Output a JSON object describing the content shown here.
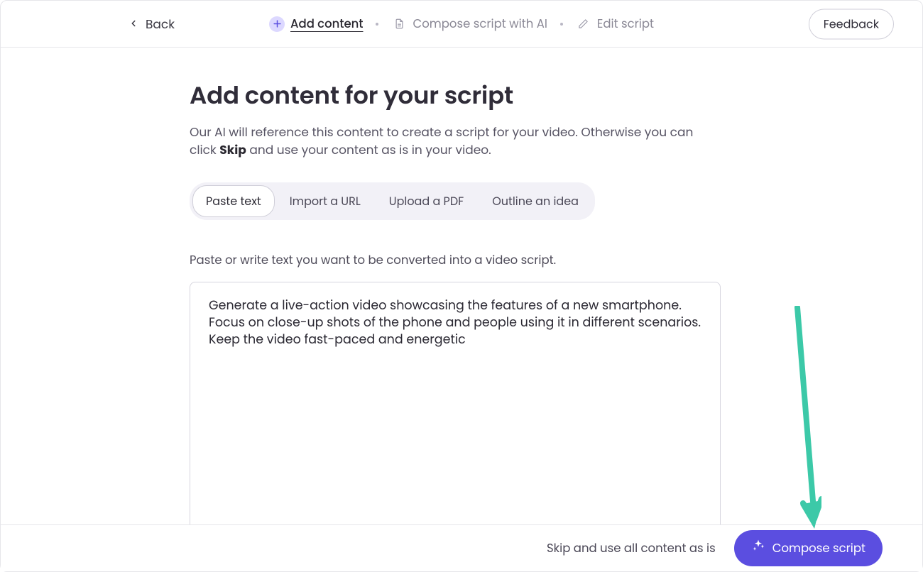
{
  "header": {
    "back_label": "Back",
    "steps": [
      {
        "label": "Add content",
        "active": true,
        "icon": "plus"
      },
      {
        "label": "Compose script with AI",
        "active": false,
        "icon": "document"
      },
      {
        "label": "Edit script",
        "active": false,
        "icon": "pencil"
      }
    ],
    "feedback_label": "Feedback"
  },
  "main": {
    "title": "Add content for your script",
    "subtitle_before": "Our AI will reference this content to create a script for your video. Otherwise you can click ",
    "subtitle_bold": "Skip",
    "subtitle_after": " and use your content as is in your video.",
    "tabs": [
      {
        "label": "Paste text",
        "active": true
      },
      {
        "label": "Import a URL",
        "active": false
      },
      {
        "label": "Upload a PDF",
        "active": false
      },
      {
        "label": "Outline an idea",
        "active": false
      }
    ],
    "instruction": "Paste or write text you want to be converted into a video script.",
    "textarea_value": "Generate a live-action video showcasing the features of a new smartphone. Focus on close-up shots of the phone and people using it in different scenarios. Keep the video fast-paced and energetic"
  },
  "footer": {
    "skip_label": "Skip and use all content as is",
    "compose_label": "Compose script"
  },
  "colors": {
    "accent": "#5b4ee0",
    "arrow": "#3cc9a8"
  }
}
